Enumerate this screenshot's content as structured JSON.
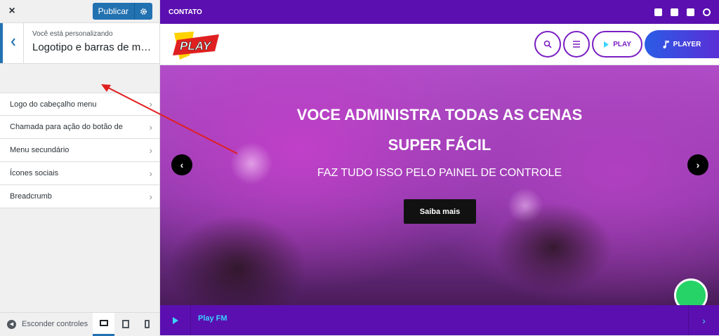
{
  "sidebar": {
    "close_icon": "×",
    "publish_label": "Publicar",
    "section_subtitle": "Você está personalizando",
    "section_title": "Logotipo e barras de menu",
    "items": [
      {
        "label": "Logo do cabeçalho menu"
      },
      {
        "label": "Chamada para ação do botão de"
      },
      {
        "label": "Menu secundário"
      },
      {
        "label": "Ícones sociais"
      },
      {
        "label": "Breadcrumb"
      }
    ],
    "footer": {
      "hide_label": "Esconder controles"
    }
  },
  "preview": {
    "topbar": {
      "link": "CONTATO",
      "social_icons": [
        "instagram-icon",
        "facebook-icon",
        "android-icon",
        "circle-icon"
      ]
    },
    "header": {
      "logo_text": "PLAY",
      "play_label": "PLAY",
      "player_label": "PLAYER"
    },
    "hero": {
      "title_line1": "VOCE ADMINISTRA TODAS AS CENAS",
      "title_line2": "SUPER FÁCIL",
      "subtitle": "FAZ TUDO ISSO PELO PAINEL DE CONTROLE",
      "cta": "Saiba mais",
      "prev_icon": "‹",
      "next_icon": "›"
    },
    "player_bar": {
      "station": "Play FM"
    }
  },
  "colors": {
    "wp_blue": "#2271b1",
    "site_purple": "#5b0fb0",
    "accent_cyan": "#3ad4ff",
    "annotation_red": "#e02020"
  }
}
